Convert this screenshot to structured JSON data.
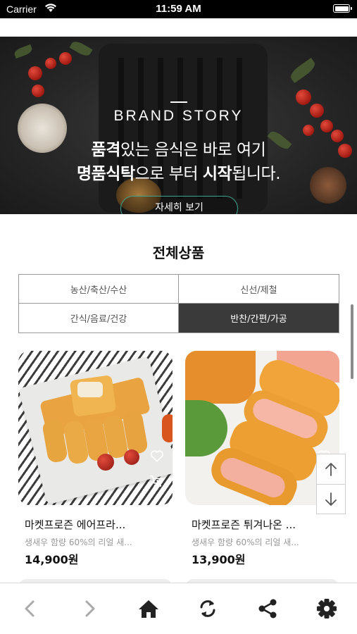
{
  "status_bar": {
    "carrier": "Carrier",
    "time": "11:59 AM"
  },
  "banner": {
    "title": "BRAND STORY",
    "line1_bold": "품격",
    "line1_rest": "있는 음식은 바로 여기",
    "line2_bold_a": "명품식탁",
    "line2_mid": "으로 부터 ",
    "line2_bold_b": "시작",
    "line2_rest": "됩니다.",
    "button_label": "자세히 보기",
    "accent_color": "#3fa58d"
  },
  "section_title": "전체상품",
  "categories": [
    {
      "label": "농산/축산/수산",
      "active": false
    },
    {
      "label": "신선/제철",
      "active": false
    },
    {
      "label": "간식/음료/건강",
      "active": false
    },
    {
      "label": "반찬/간편/가공",
      "active": true
    }
  ],
  "products": [
    {
      "name": "마켓프로즌 에어프라...",
      "desc": "생새우 함량 60%의 리얼 새...",
      "price": "14,900원"
    },
    {
      "name": "마켓프로즌 튀겨나온 ...",
      "desc": "생새우 함량 60%의 리얼 새...",
      "price": "13,900원"
    }
  ],
  "floating_buttons": {
    "up_icon": "arrow-up-icon",
    "down_icon": "arrow-down-icon"
  },
  "toolbar": [
    {
      "icon": "back-icon"
    },
    {
      "icon": "forward-icon"
    },
    {
      "icon": "home-icon"
    },
    {
      "icon": "refresh-icon"
    },
    {
      "icon": "share-icon"
    },
    {
      "icon": "settings-icon"
    }
  ]
}
